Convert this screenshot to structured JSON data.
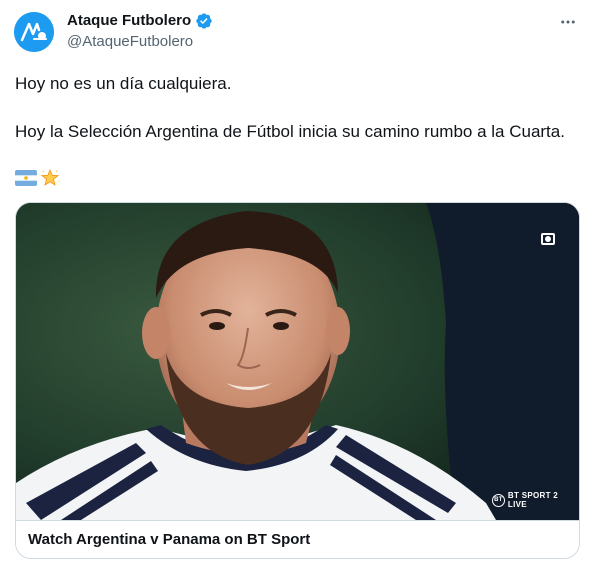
{
  "author": {
    "name": "Ataque Futbolero",
    "handle": "@AtaqueFutbolero",
    "avatar_icon": "ataque-futbolero-logo-icon",
    "verified": true,
    "verified_color": "#1d9bf0"
  },
  "menu": {
    "icon": "more-horizontal-icon"
  },
  "tweet": {
    "line1": "Hoy no es un día cualquiera.",
    "line2": "Hoy la Selección Argentina de Fútbol inicia su camino rumbo a la Cuarta.",
    "emojis": [
      "argentina-flag-icon",
      "glowing-star-icon"
    ]
  },
  "card": {
    "title": "Watch Argentina v Panama on BT Sport",
    "image_icon": "football-player-photo",
    "broadcaster_logo": "BT SPORT 2 LIVE"
  },
  "colors": {
    "text": "#0f1419",
    "secondary": "#536471",
    "border": "#cfd9de",
    "accent": "#1d9bf0"
  }
}
